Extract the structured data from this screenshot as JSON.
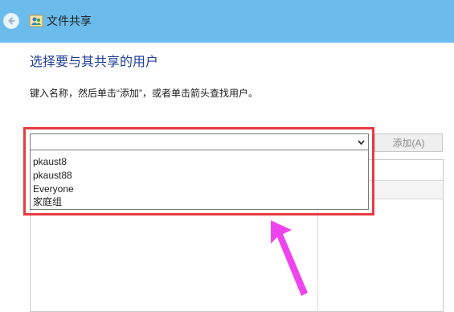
{
  "window": {
    "title": "文件共享",
    "back_icon": "back-arrow-icon",
    "title_icon": "file-sharing-people-icon",
    "titlebar_color": "#6bbcec"
  },
  "main": {
    "heading": "选择要与其共享的用户",
    "instruction": "键入名称，然后单击“添加”，或者单击箭头查找用户。",
    "heading_color": "#1f3f99"
  },
  "user_combo": {
    "value": "",
    "dropdown_icon": "chevron-down-icon",
    "options": [
      "pkaust8",
      "pkaust88",
      "Everyone",
      "家庭组"
    ]
  },
  "add_button": {
    "label": "添加(A)",
    "enabled": false
  },
  "annotation": {
    "highlight_color": "#e93a44",
    "arrow_color": "#ee44ee",
    "arrow_icon": "pointer-arrow-icon"
  }
}
